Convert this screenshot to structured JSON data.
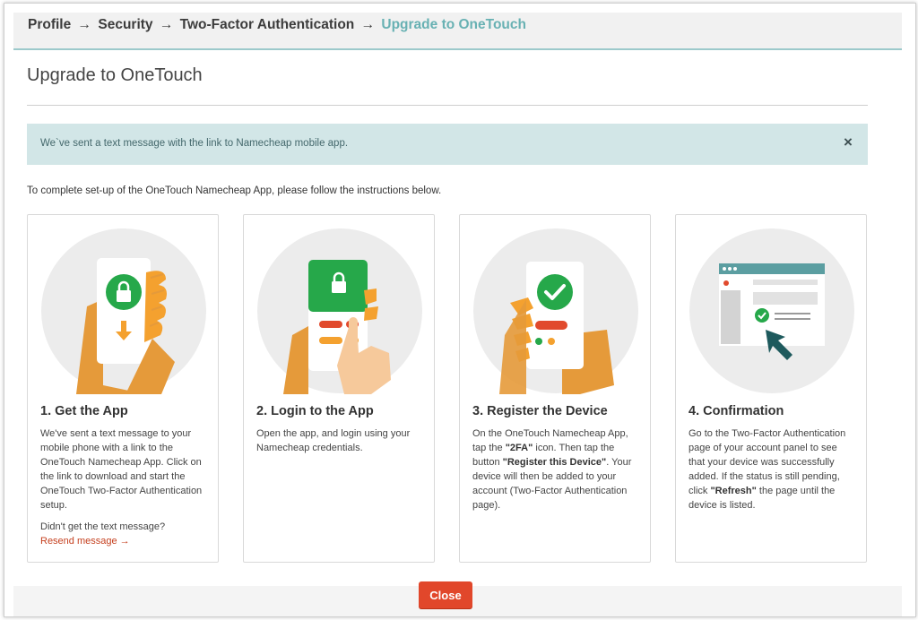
{
  "breadcrumb": {
    "items": [
      "Profile",
      "Security",
      "Two-Factor Authentication",
      "Upgrade to OneTouch"
    ],
    "separator": "→"
  },
  "page": {
    "title": "Upgrade to OneTouch"
  },
  "alert": {
    "message": "We`ve sent a text message with the link to Namecheap mobile app.",
    "close_icon": "×"
  },
  "intro": "To complete set-up of the OneTouch Namecheap App, please follow the instructions below.",
  "steps": [
    {
      "title": "1. Get the App",
      "body": "We've sent a text message to your mobile phone with a link to the OneTouch Namecheap App. Click on the link to download and start the OneTouch Two-Factor Authentication setup.",
      "extra": "Didn't get the text message?",
      "link": "Resend message →",
      "icon": "phone-download-icon"
    },
    {
      "title": "2. Login to the App",
      "body": "Open the app, and login using your Namecheap credentials.",
      "icon": "phone-login-icon"
    },
    {
      "title": "3. Register the Device",
      "body_parts": [
        "On the OneTouch Namecheap App, tap the ",
        "\"2FA\"",
        " icon. Then tap the button ",
        "\"Register this Device\"",
        ". Your device will then be added to your account (Two-Factor Authentication page)."
      ],
      "icon": "phone-register-icon"
    },
    {
      "title": "4. Confirmation",
      "body_parts": [
        "Go to the Two-Factor Authentication page of your account panel to see that your device was successfully added. If the status is still pending, click ",
        "\"Refresh\"",
        " the page until the device is listed."
      ],
      "icon": "browser-confirm-icon"
    }
  ],
  "footer": {
    "close_label": "Close"
  },
  "colors": {
    "accent": "#68b1b3",
    "alert_bg": "#d2e6e7",
    "close_button": "#e1472b",
    "green": "#26a84a",
    "orange": "#f4a12f",
    "link": "#c5401f"
  }
}
